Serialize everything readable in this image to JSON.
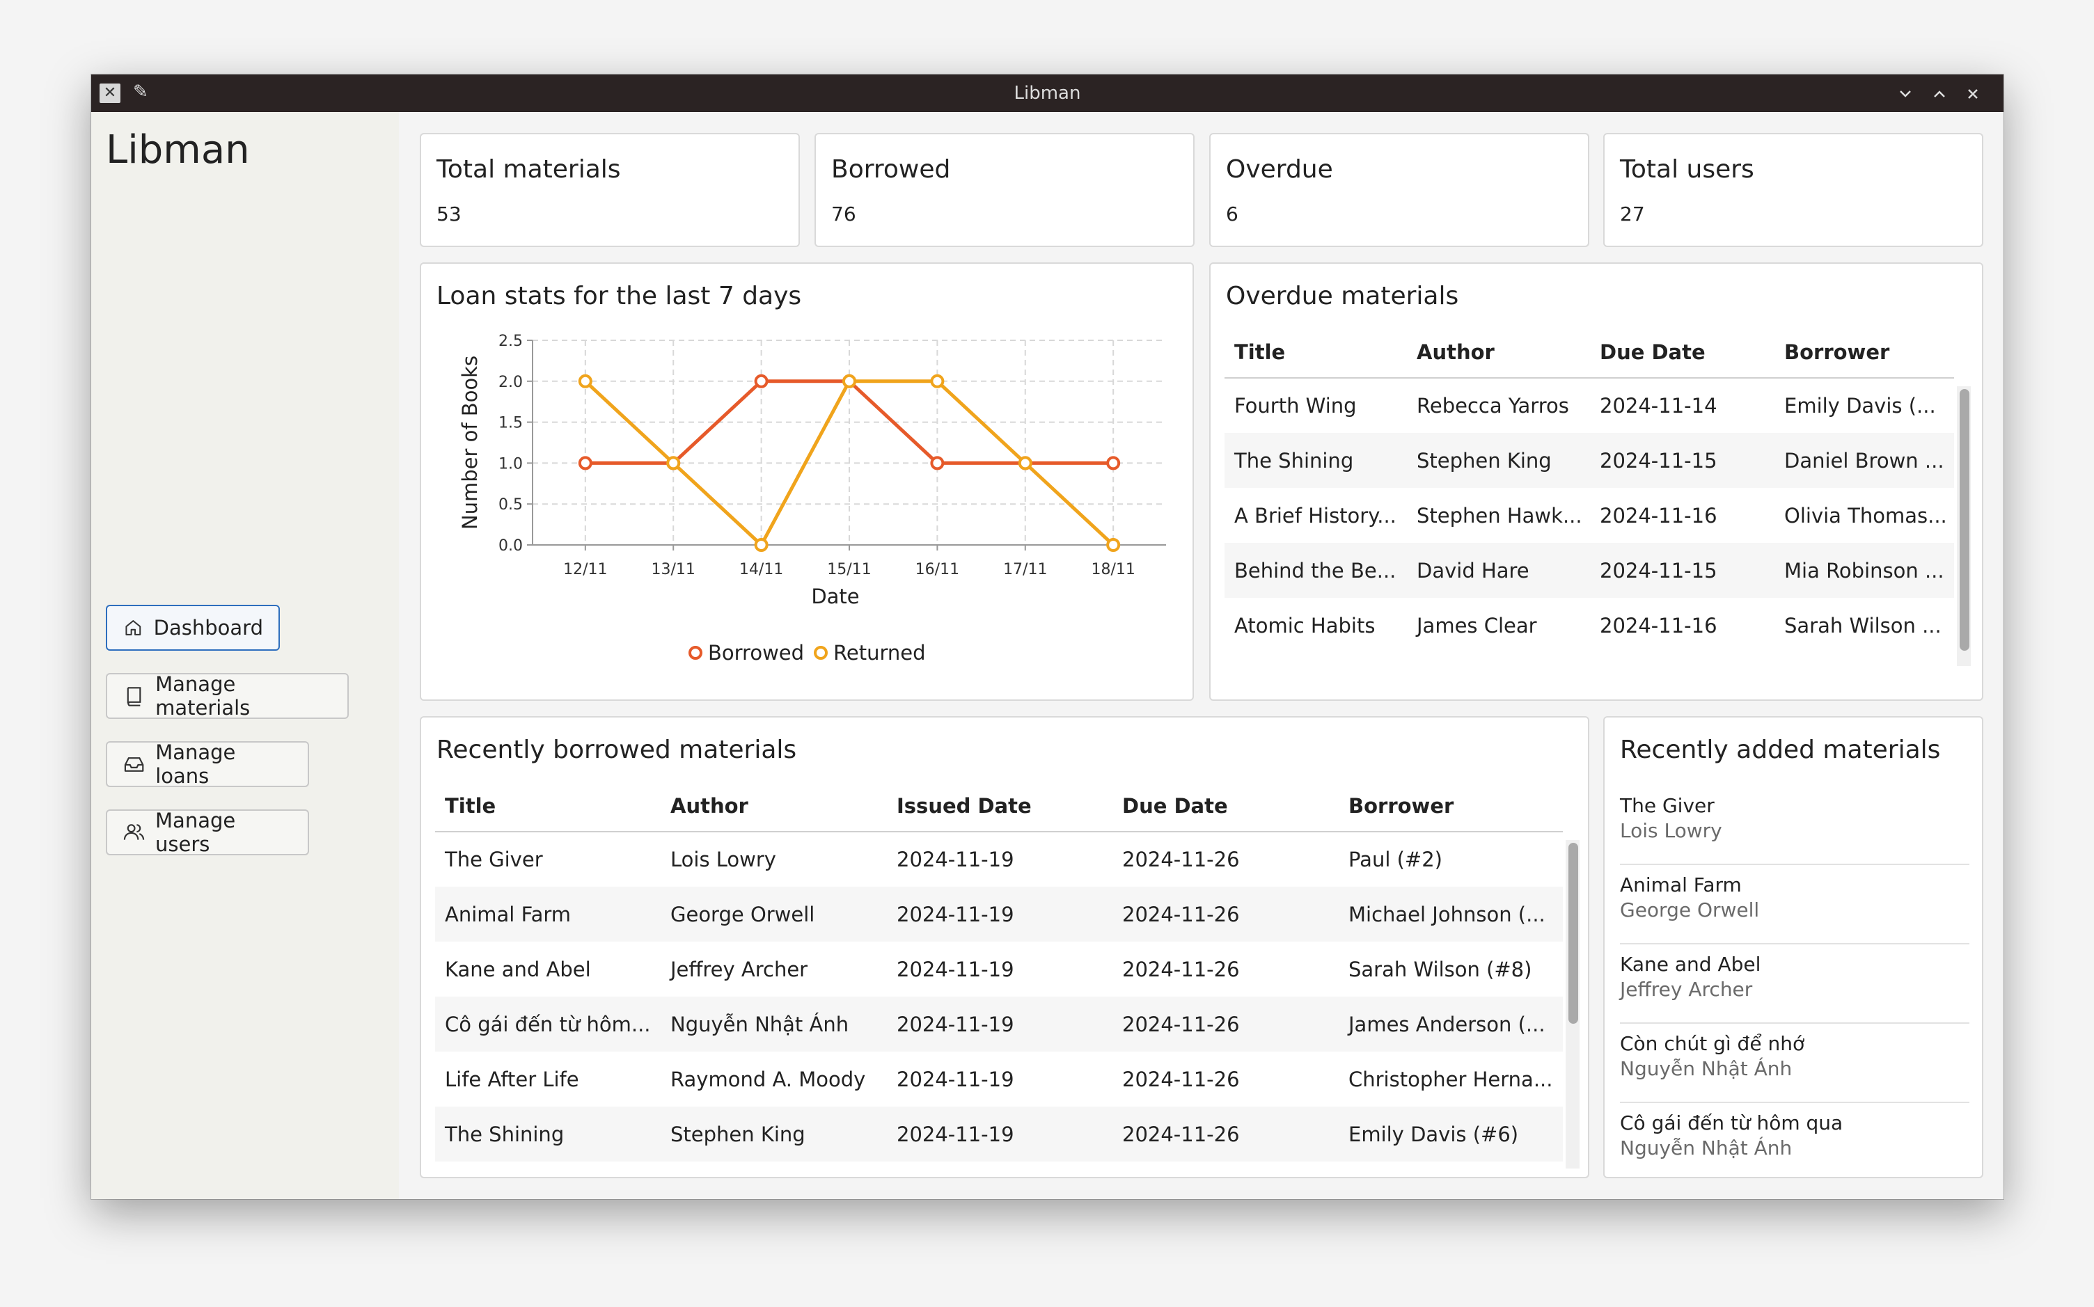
{
  "window": {
    "title": "Libman"
  },
  "sidebar": {
    "brand": "Libman",
    "nav": [
      {
        "label": "Dashboard",
        "icon": "home-icon",
        "active": true
      },
      {
        "label": "Manage materials",
        "icon": "book-icon",
        "active": false
      },
      {
        "label": "Manage loans",
        "icon": "inbox-icon",
        "active": false
      },
      {
        "label": "Manage users",
        "icon": "users-icon",
        "active": false
      }
    ],
    "footer_icons": [
      "power-icon",
      "logout-icon"
    ]
  },
  "stats": [
    {
      "label": "Total materials",
      "value": "53"
    },
    {
      "label": "Borrowed",
      "value": "76"
    },
    {
      "label": "Overdue",
      "value": "6"
    },
    {
      "label": "Total users",
      "value": "27"
    }
  ],
  "loan_chart": {
    "title": "Loan stats for the last 7 days"
  },
  "chart_data": {
    "type": "line",
    "x": [
      "12/11",
      "13/11",
      "14/11",
      "15/11",
      "16/11",
      "17/11",
      "18/11"
    ],
    "series": [
      {
        "name": "Borrowed",
        "values": [
          1.0,
          1.0,
          2.0,
          2.0,
          1.0,
          1.0,
          1.0
        ],
        "color": "#e65a2a"
      },
      {
        "name": "Returned",
        "values": [
          2.0,
          1.0,
          0.0,
          2.0,
          2.0,
          1.0,
          0.0
        ],
        "color": "#f0a41c"
      }
    ],
    "xlabel": "Date",
    "ylabel": "Number of Books",
    "ylim": [
      0,
      2.5
    ],
    "yticks": [
      "0.0",
      "0.5",
      "1.0",
      "1.5",
      "2.0",
      "2.5"
    ],
    "grid": true,
    "legend": "bottom"
  },
  "overdue": {
    "title": "Overdue materials",
    "columns": [
      "Title",
      "Author",
      "Due Date",
      "Borrower"
    ],
    "rows": [
      [
        "Fourth Wing",
        "Rebecca Yarros",
        "2024-11-14",
        "Emily Davis (..."
      ],
      [
        "The Shining",
        "Stephen King",
        "2024-11-15",
        "Daniel Brown ..."
      ],
      [
        "A Brief History...",
        "Stephen Hawk...",
        "2024-11-16",
        "Olivia Thomas..."
      ],
      [
        "Behind the Be...",
        "David Hare",
        "2024-11-15",
        "Mia Robinson ..."
      ],
      [
        "Atomic Habits",
        "James Clear",
        "2024-11-16",
        "Sarah Wilson ..."
      ]
    ]
  },
  "recent_borrowed": {
    "title": "Recently borrowed materials",
    "columns": [
      "Title",
      "Author",
      "Issued Date",
      "Due Date",
      "Borrower"
    ],
    "rows": [
      [
        "The Giver",
        "Lois Lowry",
        "2024-11-19",
        "2024-11-26",
        "Paul (#2)"
      ],
      [
        "Animal Farm",
        "George Orwell",
        "2024-11-19",
        "2024-11-26",
        "Michael Johnson (..."
      ],
      [
        "Kane and Abel",
        "Jeffrey Archer",
        "2024-11-19",
        "2024-11-26",
        "Sarah Wilson (#8)"
      ],
      [
        "Cô gái đến từ hôm...",
        "Nguyễn Nhật Ánh",
        "2024-11-19",
        "2024-11-26",
        "James Anderson (..."
      ],
      [
        "Life After Life",
        "Raymond A. Moody",
        "2024-11-19",
        "2024-11-26",
        "Christopher Herna..."
      ],
      [
        "The Shining",
        "Stephen King",
        "2024-11-19",
        "2024-11-26",
        "Emily Davis (#6)"
      ]
    ]
  },
  "recent_added": {
    "title": "Recently added materials",
    "items": [
      {
        "title": "The Giver",
        "author": "Lois Lowry"
      },
      {
        "title": "Animal Farm",
        "author": "George Orwell"
      },
      {
        "title": "Kane and Abel",
        "author": "Jeffrey Archer"
      },
      {
        "title": "Còn chút gì để nhớ",
        "author": "Nguyễn Nhật Ánh"
      },
      {
        "title": "Cô gái đến từ hôm qua",
        "author": "Nguyễn Nhật Ánh"
      }
    ]
  },
  "colors": {
    "accent": "#2e6fbe",
    "danger": "#d32f2f",
    "titlebar": "#2b2323"
  }
}
